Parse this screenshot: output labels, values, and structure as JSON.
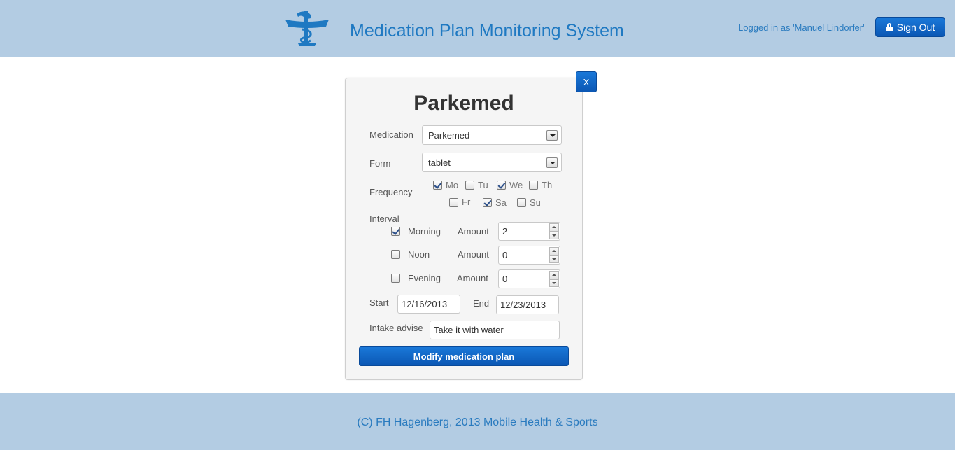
{
  "header": {
    "title": "Medication Plan Monitoring System",
    "logged_in": "Logged in as 'Manuel Lindorfer'",
    "sign_out": "Sign Out"
  },
  "dialog": {
    "close": "X",
    "title": "Parkemed",
    "medication": {
      "label": "Medication",
      "value": "Parkemed"
    },
    "form": {
      "label": "Form",
      "value": "tablet"
    },
    "frequency": {
      "label": "Frequency",
      "days": [
        {
          "label": "Mo",
          "checked": true
        },
        {
          "label": "Tu",
          "checked": false
        },
        {
          "label": "We",
          "checked": true
        },
        {
          "label": "Th",
          "checked": false
        },
        {
          "label": "Fr",
          "checked": false
        },
        {
          "label": "Sa",
          "checked": true
        },
        {
          "label": "Su",
          "checked": false
        }
      ]
    },
    "interval": {
      "label": "Interval",
      "amount_label": "Amount",
      "slots": [
        {
          "label": "Morning",
          "checked": true,
          "amount": "2"
        },
        {
          "label": "Noon",
          "checked": false,
          "amount": "0"
        },
        {
          "label": "Evening",
          "checked": false,
          "amount": "0"
        }
      ]
    },
    "start": {
      "label": "Start",
      "value": "12/16/2013"
    },
    "end": {
      "label": "End",
      "value": "12/23/2013"
    },
    "intake": {
      "label": "Intake advise",
      "value": "Take it with water"
    },
    "submit": "Modify medication plan"
  },
  "footer": {
    "text": "(C) FH Hagenberg, 2013 Mobile Health & Sports"
  },
  "colors": {
    "band": "#b3cce3",
    "accent": "#1f79c2",
    "button": "#0b57b4"
  }
}
